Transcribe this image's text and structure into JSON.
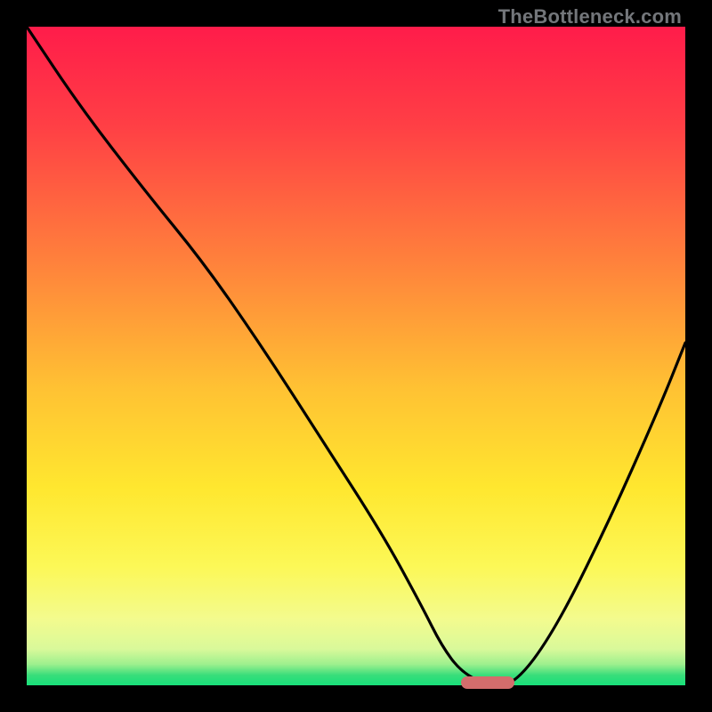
{
  "watermark": "TheBottleneck.com",
  "palette": {
    "bg": "#000000",
    "curve": "#000000",
    "marker": "#d36d6c",
    "gradient_stops": [
      {
        "offset": 0.0,
        "color": "#ff1c4a"
      },
      {
        "offset": 0.15,
        "color": "#ff3f45"
      },
      {
        "offset": 0.35,
        "color": "#ff7f3c"
      },
      {
        "offset": 0.55,
        "color": "#ffc233"
      },
      {
        "offset": 0.7,
        "color": "#ffe72f"
      },
      {
        "offset": 0.82,
        "color": "#fcf857"
      },
      {
        "offset": 0.9,
        "color": "#f3fb8e"
      },
      {
        "offset": 0.945,
        "color": "#d9f99a"
      },
      {
        "offset": 0.968,
        "color": "#9ef08e"
      },
      {
        "offset": 0.985,
        "color": "#37dd7a"
      },
      {
        "offset": 1.0,
        "color": "#18e07a"
      }
    ]
  },
  "chart_data": {
    "type": "line",
    "title": "",
    "xlabel": "",
    "ylabel": "",
    "xlim": [
      0,
      100
    ],
    "ylim": [
      0,
      100
    ],
    "series": [
      {
        "name": "bottleneck-curve",
        "x": [
          0,
          8,
          18,
          27,
          36,
          45,
          54,
          60,
          63,
          66,
          70,
          74,
          80,
          88,
          96,
          100
        ],
        "y": [
          100,
          88,
          75,
          64,
          51,
          37,
          23,
          12,
          6,
          2,
          0,
          0,
          8,
          24,
          42,
          52
        ]
      }
    ],
    "optimal_marker": {
      "x_start": 66,
      "x_end": 74,
      "y": 0
    }
  }
}
